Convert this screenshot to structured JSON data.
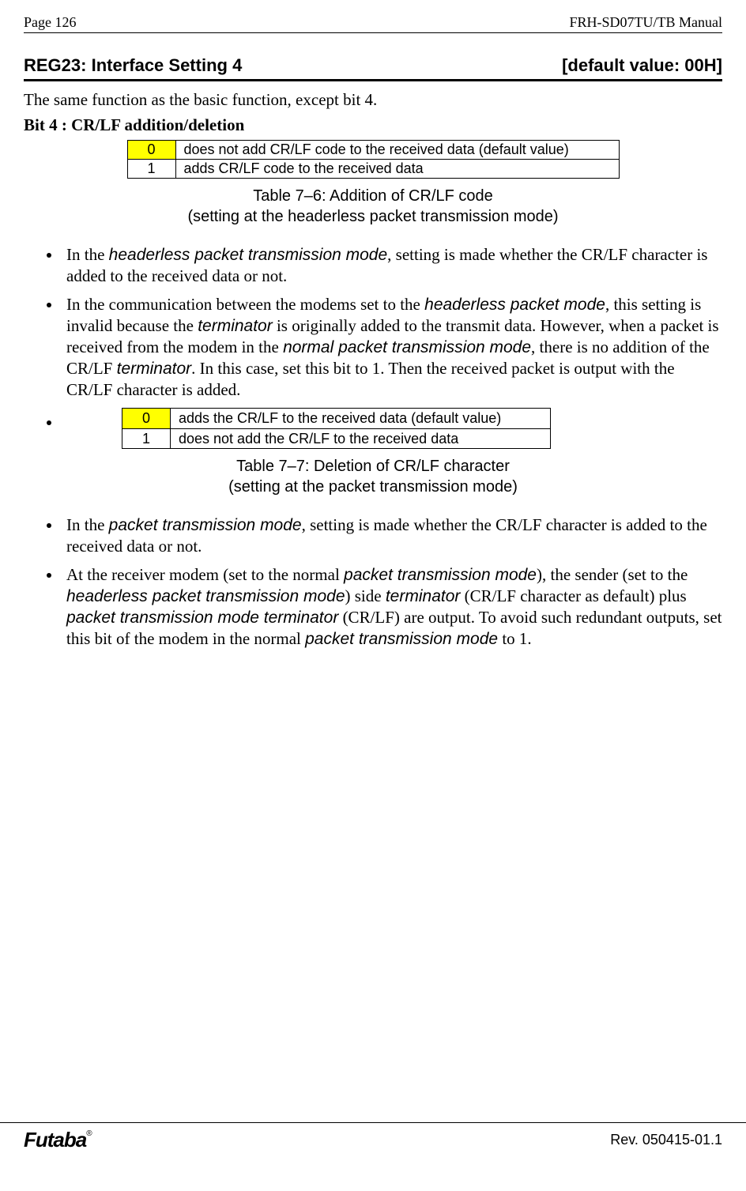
{
  "header": {
    "page_label": "Page  126",
    "manual": "FRH-SD07TU/TB Manual"
  },
  "section": {
    "title": "REG23:  Interface Setting 4",
    "default": "[default value: 00H]"
  },
  "intro": "The same function as the basic function, except bit 4.",
  "bit4_label": "Bit 4 :  CR/LF addition/deletion",
  "table1": {
    "r0": {
      "k": "0",
      "v": "does not add CR/LF code to the received data (default value)"
    },
    "r1": {
      "k": "1",
      "v": "adds CR/LF code to the received data"
    }
  },
  "caption1_line1": "Table 7–6:  Addition of CR/LF code",
  "caption1_line2": "(setting at the headerless packet transmission mode)",
  "bullet1": {
    "a": "In the ",
    "b": "headerless packet transmission mode",
    "c": ", setting is made whether the CR/LF character is added to the received data or not."
  },
  "bullet2": {
    "a": "In the communication between the modems set to the ",
    "b": "headerless packet mode",
    "c": ", this setting is invalid because the ",
    "d": "terminator",
    "e": " is originally added to the transmit data. However, when a packet is received from the modem in the ",
    "f": "normal packet transmission mode",
    "g": ", there is no addition of the CR/LF ",
    "h": "terminator",
    "i": ". In this case, set this bit to 1. Then the received packet is output with the CR/LF character is added."
  },
  "table2": {
    "r0": {
      "k": "0",
      "v": "adds the CR/LF to the received data (default value)"
    },
    "r1": {
      "k": "1",
      "v": "does not add the CR/LF to the received data"
    }
  },
  "caption2_line1": "Table 7–7:  Deletion of CR/LF character",
  "caption2_line2": "(setting at the packet transmission mode)",
  "bullet3": {
    "a": "In the ",
    "b": "packet transmission mode",
    "c": ", setting is made whether the CR/LF character is added to the received data or not."
  },
  "bullet4": {
    "a": "At the receiver modem (set to the normal ",
    "b": "packet transmission mode",
    "c": "), the sender (set to the ",
    "d": "headerless packet transmission mode",
    "e": ") side ",
    "f": "terminator",
    "g": " (CR/LF character as default) plus ",
    "h": "packet transmission mode terminator",
    "i": " (CR/LF) are output. To avoid such redundant outputs, set this bit of the modem in the normal ",
    "j": "packet transmission mode",
    "k": " to 1."
  },
  "footer": {
    "logo": "Futaba",
    "reg": "®",
    "rev": "Rev. 050415-01.1"
  }
}
